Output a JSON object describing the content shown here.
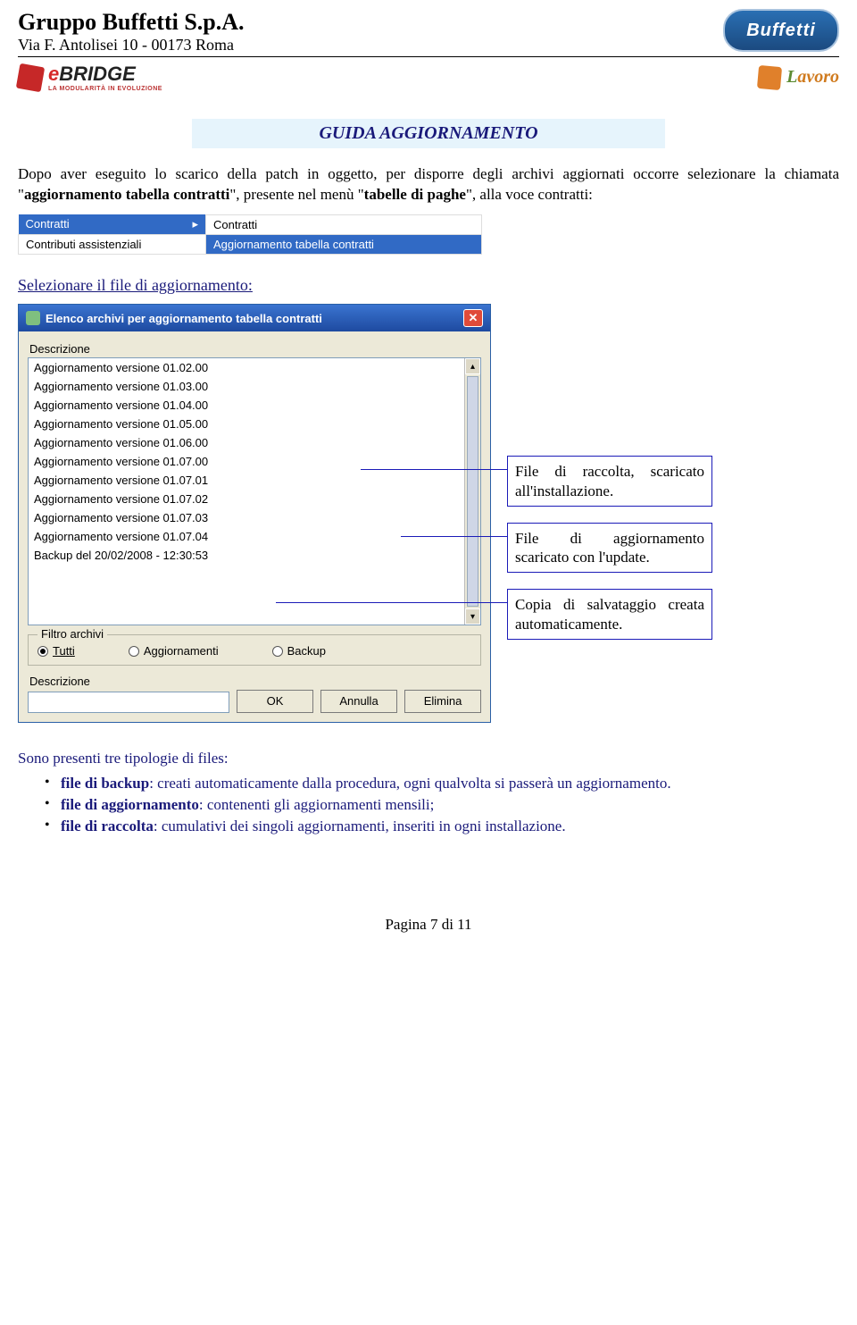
{
  "header": {
    "company": "Gruppo Buffetti S.p.A.",
    "address": "Via F. Antolisei 10 - 00173 Roma",
    "logo_buffetti_text": "Buffetti",
    "ebridge_e": "e",
    "ebridge_bridge": "BRIDGE",
    "ebridge_sub": "LA MODULARITÀ IN EVOLUZIONE",
    "lavoro_l": "L",
    "lavoro_rest": "avoro"
  },
  "title": "GUIDA AGGIORNAMENTO",
  "intro_before": "Dopo aver eseguito lo scarico della patch in oggetto, per disporre degli archivi aggiornati occorre selezionare la chiamata \"",
  "intro_bold1": "aggiornamento tabella contratti",
  "intro_mid1": "\", presente nel menù \"",
  "intro_bold2": "tabelle di paghe",
  "intro_mid2": "\", alla voce contratti:",
  "menu": {
    "left1": "Contratti",
    "left2": "Contributi assistenziali",
    "right1": "Contratti",
    "right2": "Aggiornamento tabella contratti",
    "arrow": "▸"
  },
  "section_heading": "Selezionare il file di aggiornamento:",
  "window": {
    "title": "Elenco archivi per aggiornamento tabella contratti",
    "desc_label": "Descrizione",
    "close": "✕",
    "items": [
      "Aggiornamento versione 01.02.00",
      "Aggiornamento versione 01.03.00",
      "Aggiornamento versione 01.04.00",
      "Aggiornamento versione 01.05.00",
      "Aggiornamento versione 01.06.00",
      "Aggiornamento versione 01.07.00",
      "Aggiornamento versione 01.07.01",
      "Aggiornamento versione 01.07.02",
      "Aggiornamento versione 01.07.03",
      "Aggiornamento versione 01.07.04",
      "Backup del 20/02/2008 - 12:30:53"
    ],
    "scroll_up": "▴",
    "scroll_down": "▾",
    "group_legend": "Filtro archivi",
    "radio_all": "Tutti",
    "radio_upd": "Aggiornamenti",
    "radio_bkp": "Backup",
    "desc2": "Descrizione",
    "btn_ok": "OK",
    "btn_cancel": "Annulla",
    "btn_del": "Elimina"
  },
  "callouts": {
    "c1": "File di raccolta, scaricato all'installazione.",
    "c2": "File di aggiornamento scaricato con l'update.",
    "c3": "Copia di salvataggio creata automaticamente."
  },
  "after": {
    "intro": "Sono presenti tre tipologie di files:",
    "b1_bold": "file di backup",
    "b1_rest": ": creati automaticamente dalla procedura, ogni qualvolta si passerà un aggiornamento.",
    "b2_bold": "file di aggiornamento",
    "b2_rest": ": contenenti gli aggiornamenti mensili;",
    "b3_bold": "file di raccolta",
    "b3_rest": ": cumulativi dei singoli aggiornamenti, inseriti in ogni installazione."
  },
  "footer": "Pagina 7 di 11"
}
